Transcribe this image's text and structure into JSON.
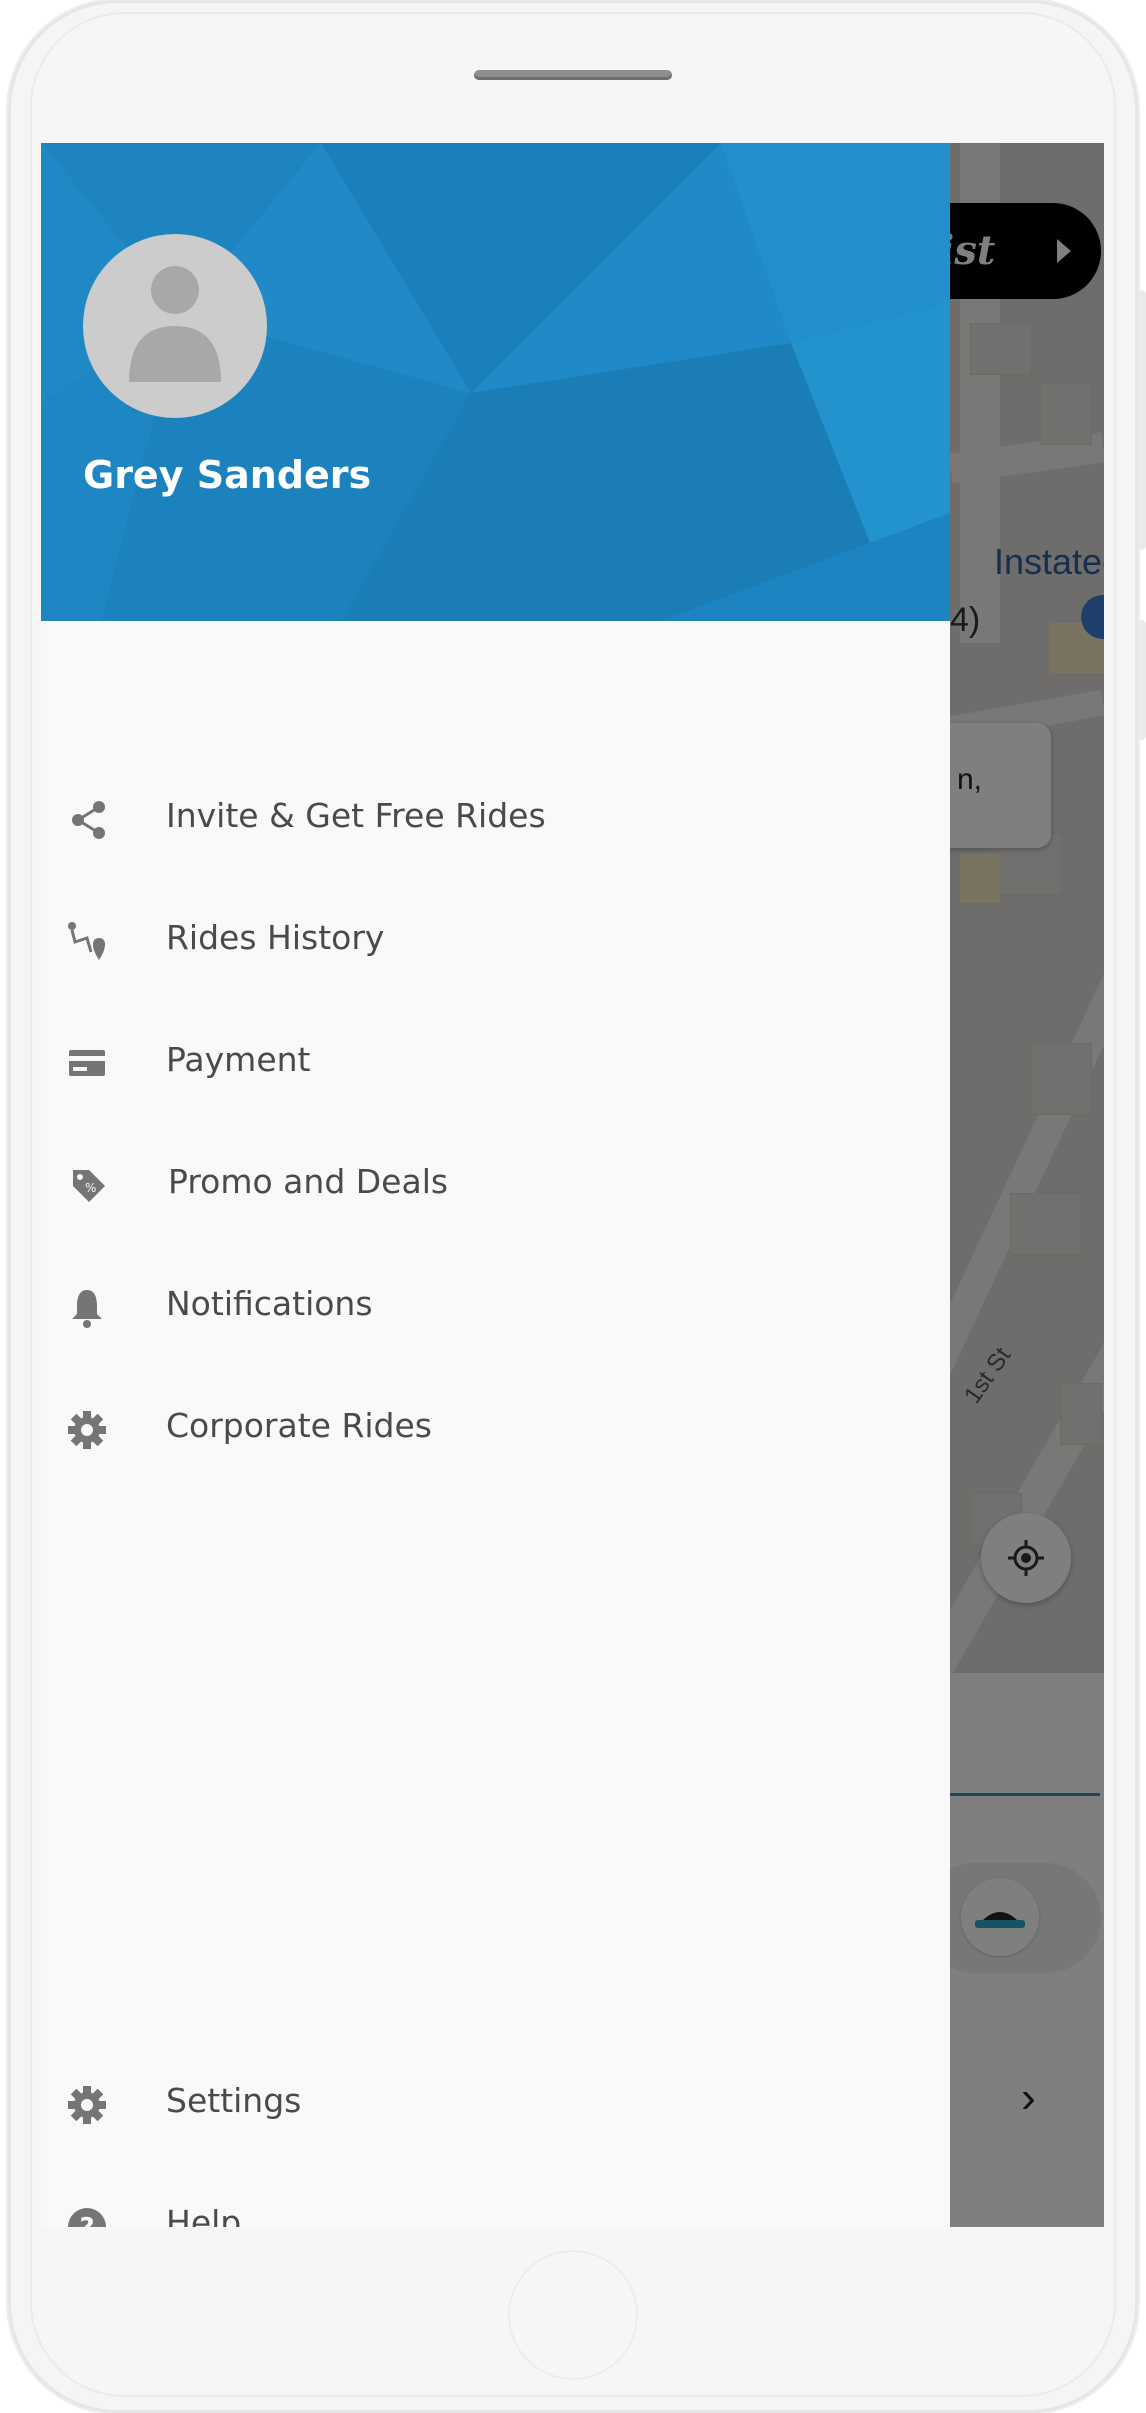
{
  "drawer": {
    "user_name": "Grey Sanders",
    "menu": [
      {
        "label": "Invite & Get Free Rides",
        "icon": "share-icon"
      },
      {
        "label": "Rides History",
        "icon": "route-icon"
      },
      {
        "label": "Payment",
        "icon": "credit-card-icon"
      },
      {
        "label": "Promo and Deals",
        "icon": "tag-icon"
      },
      {
        "label": "Notifications",
        "icon": "bell-icon"
      },
      {
        "label": "Corporate Rides",
        "icon": "gear-icon"
      }
    ],
    "footer_menu": [
      {
        "label": "Settings",
        "icon": "gear-icon"
      },
      {
        "label": "Help",
        "icon": "help-icon"
      }
    ]
  },
  "map": {
    "list_button": "List",
    "place_label": "Instated",
    "place_suffix": "4)",
    "street_label": "1st St",
    "card_text": "n,"
  },
  "colors": {
    "header_blue": "#1f8ac7",
    "drawer_bg": "#f9f9f9",
    "icon_grey": "#757575",
    "text_grey": "#4a4a4a"
  }
}
